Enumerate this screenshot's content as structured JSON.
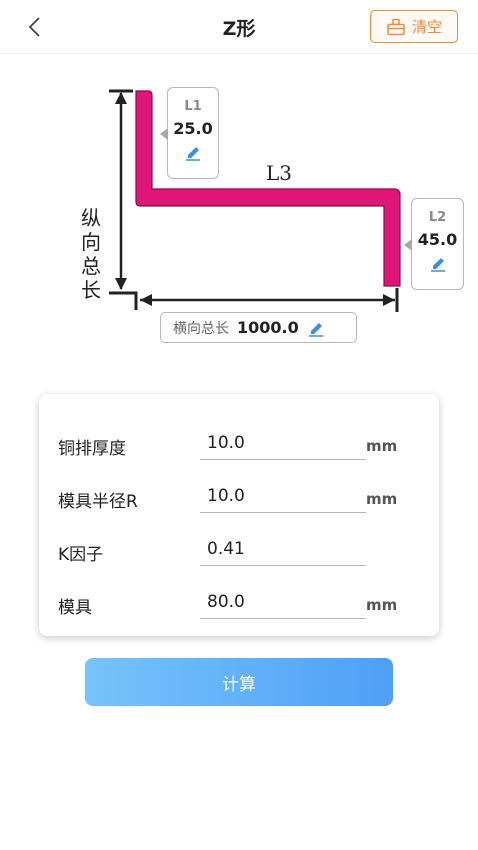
{
  "header": {
    "title": "Z形",
    "clear_label": "清空"
  },
  "diagram": {
    "vertical_label_chars": [
      "纵",
      "向",
      "总",
      "长"
    ],
    "l3_label": "L3",
    "l1": {
      "name": "L1",
      "value": "25.0"
    },
    "l2": {
      "name": "L2",
      "value": "45.0"
    },
    "horizontal": {
      "label": "横向总长",
      "value": "1000.0"
    },
    "shape_color": "#e0157a"
  },
  "form": {
    "rows": [
      {
        "label": "铜排厚度",
        "value": "10.0",
        "unit": "mm"
      },
      {
        "label": "模具半径R",
        "value": "10.0",
        "unit": "mm"
      },
      {
        "label": "K因子",
        "value": "0.41",
        "unit": ""
      },
      {
        "label": "模具",
        "value": "80.0",
        "unit": "mm"
      }
    ]
  },
  "calc_label": "计算",
  "colors": {
    "accent_orange": "#f08a3c",
    "button_blue_start": "#77c3fb",
    "button_blue_end": "#4f9ff7",
    "edit_icon_blue": "#3a8ee6"
  }
}
